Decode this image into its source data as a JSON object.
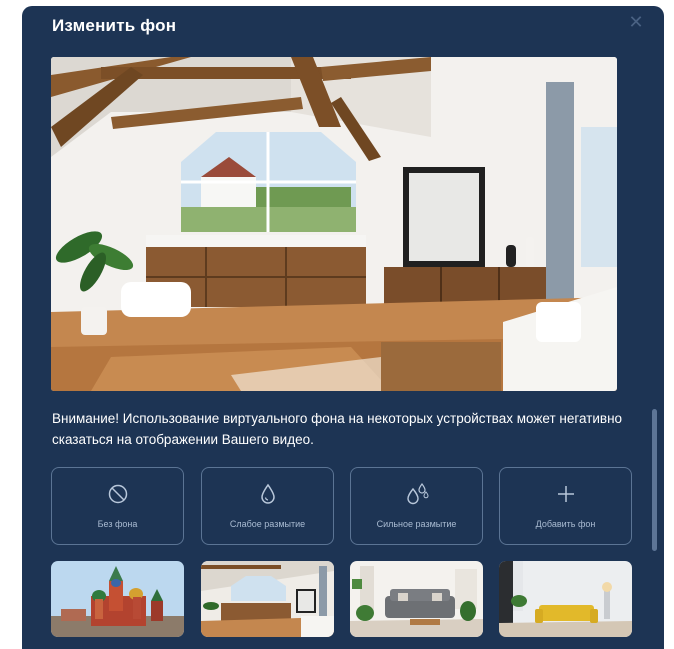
{
  "dialog": {
    "title": "Изменить фон",
    "close_icon": "close-icon"
  },
  "warning": "Внимание! Использование виртуального фона на некоторых устройствах может негативно сказаться на отображении Вашего видео.",
  "options": [
    {
      "label": "Без фона",
      "icon": "no-background-icon"
    },
    {
      "label": "Слабое размытие",
      "icon": "drop-icon"
    },
    {
      "label": "Сильное размытие",
      "icon": "drops-icon"
    },
    {
      "label": "Добавить фон",
      "icon": "plus-icon"
    }
  ],
  "thumbnails": [
    "cathedral",
    "attic-room",
    "living-room-gray-sofa",
    "room-yellow-sofa"
  ],
  "colors": {
    "dialog_bg": "#1d3454",
    "border": "#5b7494",
    "option_text": "#a9bbd2"
  }
}
